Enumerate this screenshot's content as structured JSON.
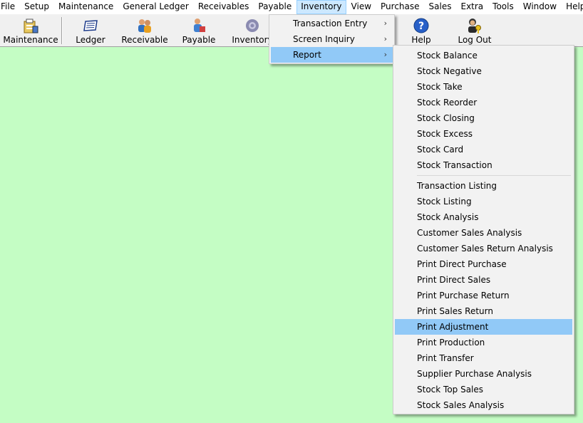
{
  "menubar": {
    "items": [
      "File",
      "Setup",
      "Maintenance",
      "General Ledger",
      "Receivables",
      "Payable",
      "Inventory",
      "View",
      "Purchase",
      "Sales",
      "Extra",
      "Tools",
      "Window",
      "Help"
    ],
    "active": "Inventory"
  },
  "toolbar": {
    "maintenance_label": "Maintenance",
    "ledger_label": "Ledger",
    "receivable_label": "Receivable",
    "payable_label": "Payable",
    "inventory_label": "Inventory",
    "help_label": "Help",
    "logout_label": "Log Out"
  },
  "inventory_menu": {
    "items": [
      "Transaction Entry",
      "Screen Inquiry",
      "Report"
    ],
    "highlighted": "Report"
  },
  "report_menu": {
    "group1": [
      "Stock Balance",
      "Stock Negative",
      "Stock Take",
      "Stock Reorder",
      "Stock Closing",
      "Stock Excess",
      "Stock Card",
      "Stock Transaction"
    ],
    "group2": [
      "Transaction Listing",
      "Stock Listing",
      "Stock Analysis",
      "Customer Sales Analysis",
      "Customer Sales Return Analysis",
      "Print Direct Purchase",
      "Print Direct Sales",
      "Print Purchase Return",
      "Print Sales Return",
      "Print Adjustment",
      "Print Production",
      "Print Transfer",
      "Supplier Purchase Analysis",
      "Stock Top Sales",
      "Stock Sales Analysis"
    ],
    "highlighted": "Print Adjustment"
  },
  "colors": {
    "workspace": "#c4fdc4",
    "menu_highlight": "#91c9f7",
    "active_menu": "#cce8ff"
  }
}
